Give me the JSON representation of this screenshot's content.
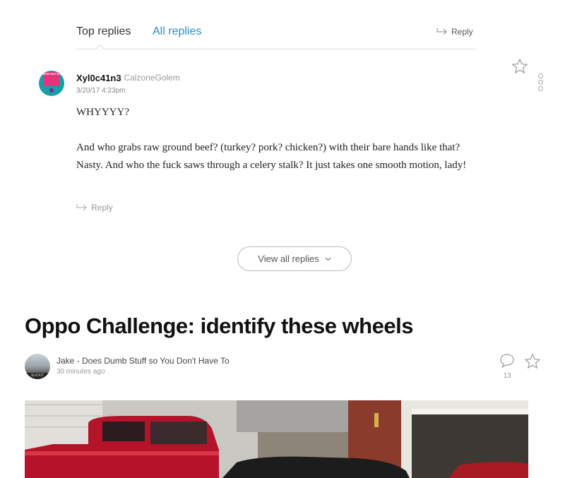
{
  "tabs": {
    "top_replies": "Top replies",
    "all_replies": "All replies",
    "reply": "Reply"
  },
  "comment": {
    "author": "Xyl0c41n3",
    "reply_to": "CalzoneGolem",
    "timestamp": "3/20/17 4:23pm",
    "avatar_text": "PRESS BUTTON",
    "paragraphs": [
      "WHYYYY?",
      "And who grabs raw ground beef? (turkey? pork? chicken?) with their bare hands like that? Nasty. And who the fuck saws through a celery stalk? It just takes one smooth motion, lady!"
    ],
    "reply": "Reply"
  },
  "view_all": {
    "label": "View all replies"
  },
  "article": {
    "headline": "Oppo Challenge: identify these wheels",
    "author": "Jake - Does Dumb Stuff so You Don't Have To",
    "time": "30 minutes ago",
    "comment_count": "13",
    "avatar_text": "SUCKIT"
  },
  "colors": {
    "accent": "#2a8fc4",
    "truck_red": "#b5132a"
  },
  "icons": [
    "reply-arrow-icon",
    "star-icon",
    "more-icon",
    "chevron-down-icon",
    "comment-bubble-icon"
  ]
}
